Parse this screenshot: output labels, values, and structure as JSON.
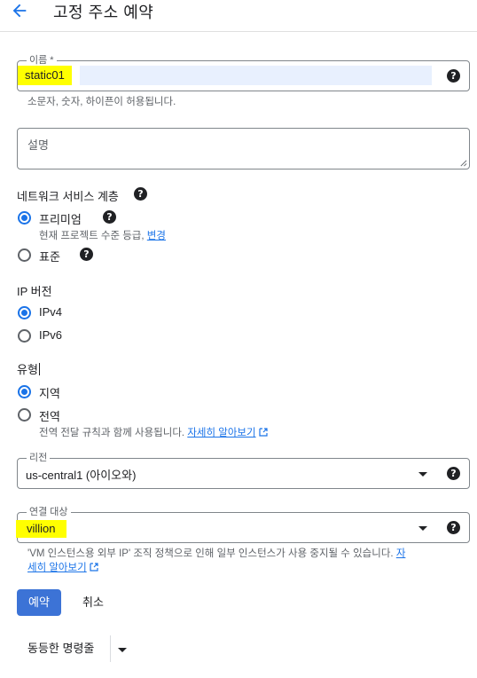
{
  "header": {
    "title": "고정 주소 예약"
  },
  "name_field": {
    "label": "이름 *",
    "value": "static01",
    "hint": "소문자, 숫자, 하이픈이 허용됩니다."
  },
  "description_field": {
    "placeholder": "설명"
  },
  "network_tier": {
    "label": "네트워크 서비스 계층",
    "options": [
      {
        "label": "프리미엄",
        "sublabel": "현재 프로젝트 수준 등급,",
        "sublink": "변경",
        "checked": true
      },
      {
        "label": "표준",
        "checked": false
      }
    ]
  },
  "ip_version": {
    "label": "IP 버전",
    "options": [
      {
        "label": "IPv4",
        "checked": true
      },
      {
        "label": "IPv6",
        "checked": false
      }
    ]
  },
  "type": {
    "label": "유형",
    "options": [
      {
        "label": "지역",
        "checked": true
      },
      {
        "label": "전역",
        "sublabel": "전역 전달 규칙과 함께 사용됩니다.",
        "sublink": "자세히 알아보기",
        "checked": false
      }
    ]
  },
  "region_field": {
    "label": "리전",
    "value": "us-central1 (아이오와)"
  },
  "attach_field": {
    "label": "연결 대상",
    "value": "villion",
    "hint_line1": "'VM 인스턴스용 외부 IP' 조직 정책으로 인해 일부 인스턴스가 사용 중지될 수 있습니다.",
    "hint_link1": "자",
    "hint_link2": "세히 알아보기"
  },
  "actions": {
    "reserve": "예약",
    "cancel": "취소",
    "equivalent_cmd": "동등한 명령줄"
  },
  "colors": {
    "accent": "#1a73e8",
    "primary_button": "#3c73d6",
    "highlight": "#ffff00"
  }
}
